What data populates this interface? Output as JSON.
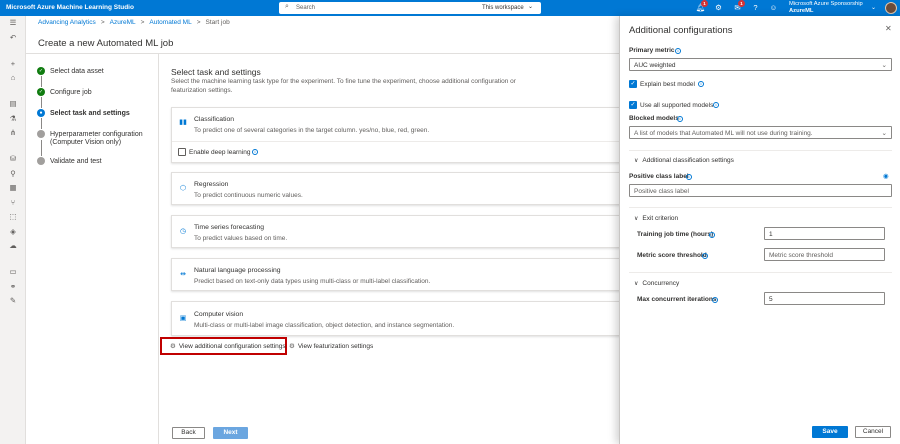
{
  "topbar": {
    "brand": "Microsoft Azure Machine Learning Studio",
    "search_placeholder": "Search",
    "search_scope": "This workspace",
    "notifications_badge": "1",
    "feedback_badge": "1",
    "account_name": "Microsoft Azure Sponsorship",
    "account_sub": "AzureML"
  },
  "breadcrumb": {
    "items": [
      "Advancing Analytics",
      "AzureML",
      "Automated ML",
      "Start job"
    ]
  },
  "page": {
    "title": "Create a new Automated ML job"
  },
  "steps": [
    {
      "label": "Select data asset",
      "state": "done"
    },
    {
      "label": "Configure job",
      "state": "done"
    },
    {
      "label": "Select task and settings",
      "state": "current"
    },
    {
      "label": "Hyperparameter configuration",
      "label2": "(Computer Vision only)",
      "state": "todo"
    },
    {
      "label": "Validate and test",
      "state": "todo"
    }
  ],
  "main": {
    "section_title": "Select task and settings",
    "section_desc": "Select the machine learning task type for the experiment. To fine tune the experiment, choose additional configuration or featurization settings.",
    "tasks": [
      {
        "title": "Classification",
        "desc": "To predict one of several categories in the target column. yes/no, blue, red, green.",
        "icon": "bar-chart-icon"
      },
      {
        "title": "Regression",
        "desc": "To predict continuous numeric values.",
        "icon": "cube-icon"
      },
      {
        "title": "Time series forecasting",
        "desc": "To predict values based on time.",
        "icon": "clock-icon"
      },
      {
        "title": "Natural language processing",
        "desc": "Predict based on text-only data types using multi-class or multi-label classification.",
        "icon": "nlp-icon"
      },
      {
        "title": "Computer vision",
        "desc": "Multi-class or multi-label image classification, object detection, and instance segmentation.",
        "icon": "image-icon"
      }
    ],
    "deep_learning_label": "Enable deep learning",
    "view_additional": "View additional configuration settings",
    "view_featurization": "View featurization settings",
    "back_label": "Back",
    "next_label": "Next"
  },
  "panel": {
    "title": "Additional configurations",
    "primary_metric_label": "Primary metric",
    "primary_metric_value": "AUC weighted",
    "explain_best_model": "Explain best model",
    "use_all_models": "Use all supported models",
    "blocked_models_label": "Blocked models",
    "blocked_models_placeholder": "A list of models that Automated ML will not use during training.",
    "additional_classification": "Additional classification settings",
    "positive_class_label": "Positive class label",
    "positive_class_placeholder": "Positive class label",
    "exit_criterion": "Exit criterion",
    "training_time_label": "Training job time (hours)",
    "training_time_value": "1",
    "metric_threshold_label": "Metric score threshold",
    "metric_threshold_placeholder": "Metric score threshold",
    "concurrency": "Concurrency",
    "max_iterations_label": "Max concurrent iterations",
    "max_iterations_value": "5",
    "save_label": "Save",
    "cancel_label": "Cancel"
  },
  "colors": {
    "accent": "#0078d4",
    "success": "#107c10",
    "highlight": "#c00000"
  }
}
